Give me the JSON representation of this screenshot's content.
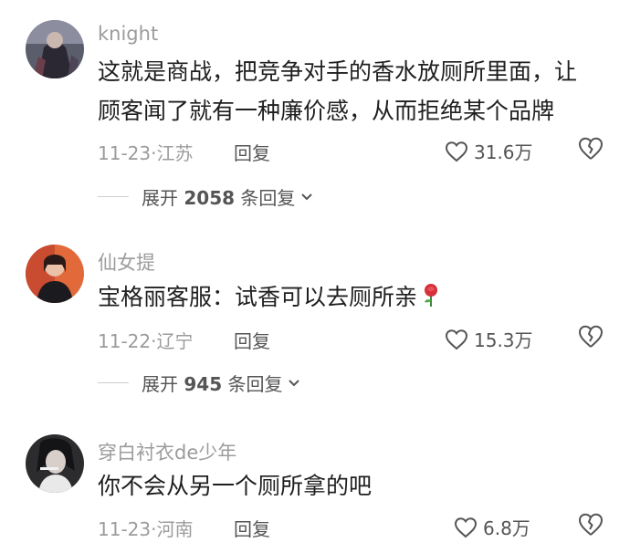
{
  "comments": [
    {
      "username": "knight",
      "text_lines": [
        "这就是商战，把竞争对手的香水放厕所里面，让",
        "顾客闻了就有一种廉价感，从而拒绝某个品牌"
      ],
      "date": "11-23",
      "location": "江苏",
      "reply_label": "回复",
      "likes": "31.6万",
      "expand": {
        "prefix": "展开",
        "count": "2058",
        "suffix": "条回复"
      }
    },
    {
      "username": "仙女提",
      "text_lines": [
        "宝格丽客服：试香可以去厕所亲"
      ],
      "emoji": "rose-emoji",
      "date": "11-22",
      "location": "辽宁",
      "reply_label": "回复",
      "likes": "15.3万",
      "expand": {
        "prefix": "展开",
        "count": "945",
        "suffix": "条回复"
      }
    },
    {
      "username": "穿白衬衣de少年",
      "text_lines": [
        "你不会从另一个厕所拿的吧"
      ],
      "date": "11-23",
      "location": "河南",
      "reply_label": "回复",
      "likes": "6.8万"
    }
  ],
  "meta_separator": "·",
  "colors": {
    "meta": "#9c9c9c",
    "text": "#1f1f1f",
    "action": "#555555"
  },
  "icons": {
    "like": "heart-outline-icon",
    "dislike": "broken-heart-icon",
    "expand": "chevron-down-icon"
  }
}
